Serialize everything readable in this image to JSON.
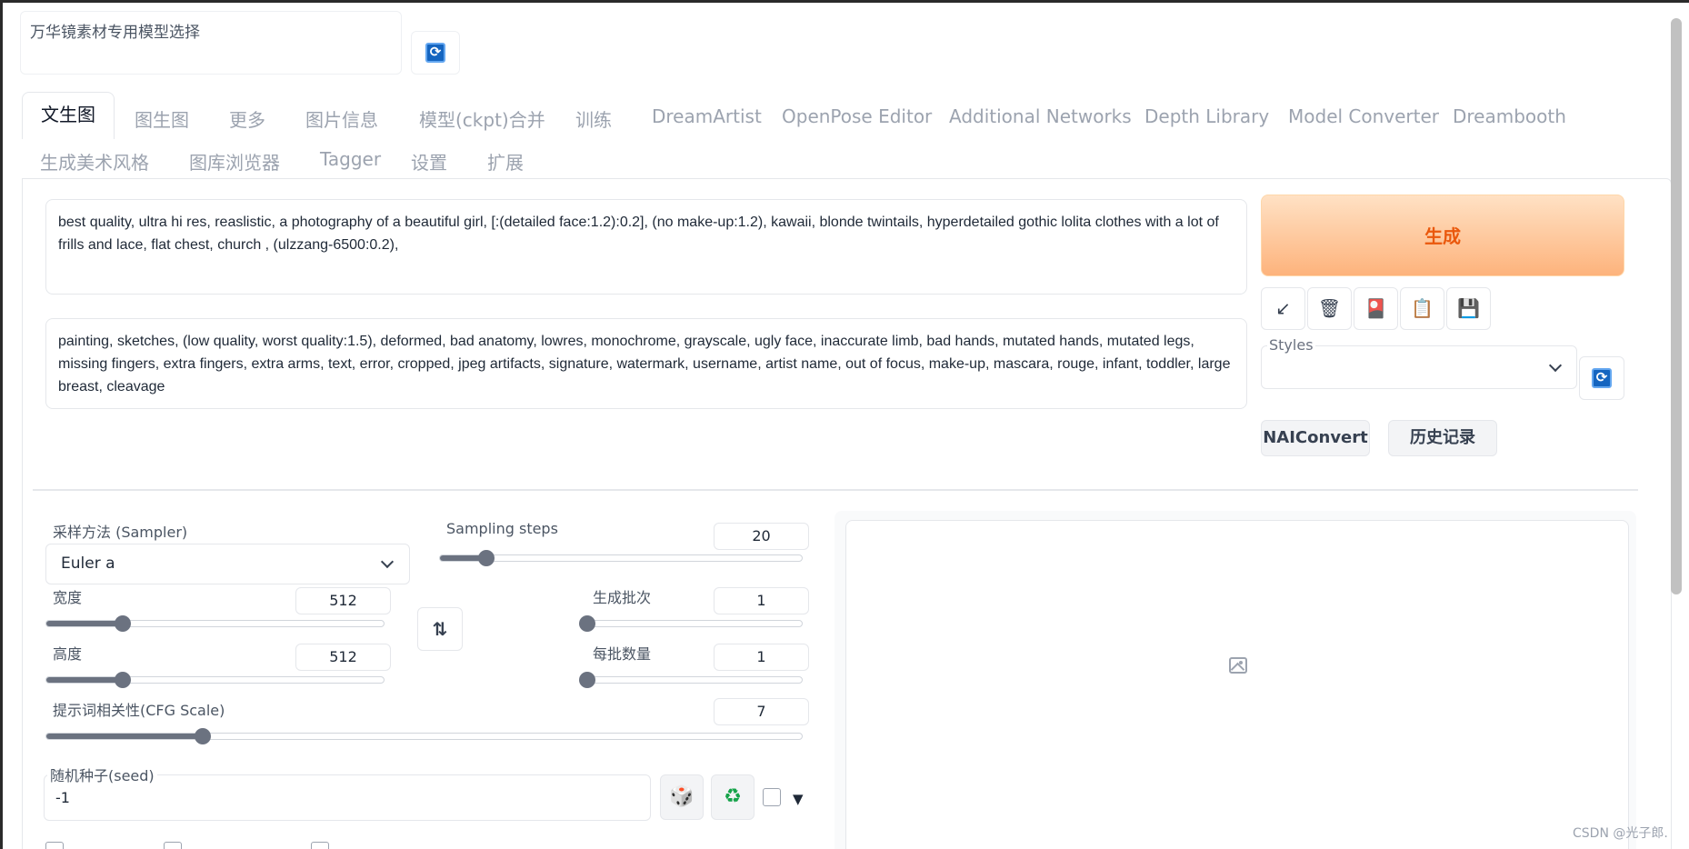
{
  "model_selector": {
    "label": "万华镜素材专用模型选择"
  },
  "tabs": [
    {
      "label": "文生图",
      "active": true
    },
    {
      "label": "图生图"
    },
    {
      "label": "更多"
    },
    {
      "label": "图片信息"
    },
    {
      "label": "模型(ckpt)合并"
    },
    {
      "label": "训练"
    },
    {
      "label": "DreamArtist"
    },
    {
      "label": "OpenPose Editor"
    },
    {
      "label": "Additional Networks"
    },
    {
      "label": "Depth Library"
    },
    {
      "label": "Model Converter"
    },
    {
      "label": "Dreambooth"
    },
    {
      "label": "生成美术风格"
    },
    {
      "label": "图库浏览器"
    },
    {
      "label": "Tagger"
    },
    {
      "label": "设置"
    },
    {
      "label": "扩展"
    }
  ],
  "prompt": {
    "positive": "best quality, ultra hi res, reaslistic, a photography of a beautiful girl, [:(detailed face:1.2):0.2], (no make-up:1.2), kawaii, blonde twintails, hyperdetailed gothic lolita clothes with a lot of frills and lace, flat chest, church , (ulzzang-6500:0.2),",
    "negative": "painting, sketches, (low quality, worst quality:1.5), deformed, bad anatomy, lowres, monochrome, grayscale, ugly face, inaccurate limb, bad hands, mutated hands, mutated legs, missing fingers, extra fingers, extra arms, text, error, cropped, jpeg artifacts, signature, watermark, username, artist name, out of focus, make-up, mascara, rouge, infant, toddler, large breast, cleavage"
  },
  "actions": {
    "generate_label": "生成",
    "tool_icons": [
      "arrow-down-left-icon",
      "trash-icon",
      "card-icon",
      "clipboard-icon",
      "save-icon"
    ],
    "tool_glyphs": [
      "↙",
      "🗑",
      "🎴",
      "📋",
      "💾"
    ],
    "styles_label": "Styles",
    "naiconvert_label": "NAIConvert",
    "history_label": "历史记录"
  },
  "params": {
    "sampler_label": "采样方法 (Sampler)",
    "sampler_value": "Euler a",
    "steps_label": "Sampling steps",
    "steps_value": "20",
    "steps": {
      "value": 20,
      "min": 1,
      "max": 150
    },
    "width_label": "宽度",
    "width_value": "512",
    "width": {
      "value": 512,
      "min": 64,
      "max": 2048
    },
    "height_label": "高度",
    "height_value": "512",
    "height": {
      "value": 512,
      "min": 64,
      "max": 2048
    },
    "batch_count_label": "生成批次",
    "batch_count_value": "1",
    "batch_count": {
      "value": 1,
      "min": 1,
      "max": 100
    },
    "batch_size_label": "每批数量",
    "batch_size_value": "1",
    "batch_size": {
      "value": 1,
      "min": 1,
      "max": 8
    },
    "cfg_label": "提示词相关性(CFG Scale)",
    "cfg_value": "7",
    "cfg": {
      "value": 7,
      "min": 1,
      "max": 30
    },
    "seed_label": "随机种子(seed)",
    "seed_value": "-1",
    "swap_glyph": "⇅",
    "dice_glyph": "🎲",
    "recycle_glyph": "♻",
    "expand_glyph": "▼"
  },
  "watermark": "CSDN @光子郎.",
  "colors": {
    "generate_bg": "#fdb37c",
    "generate_text": "#ea580c",
    "refresh_blue": "#1565c0",
    "recycle_green": "#16a34a"
  }
}
